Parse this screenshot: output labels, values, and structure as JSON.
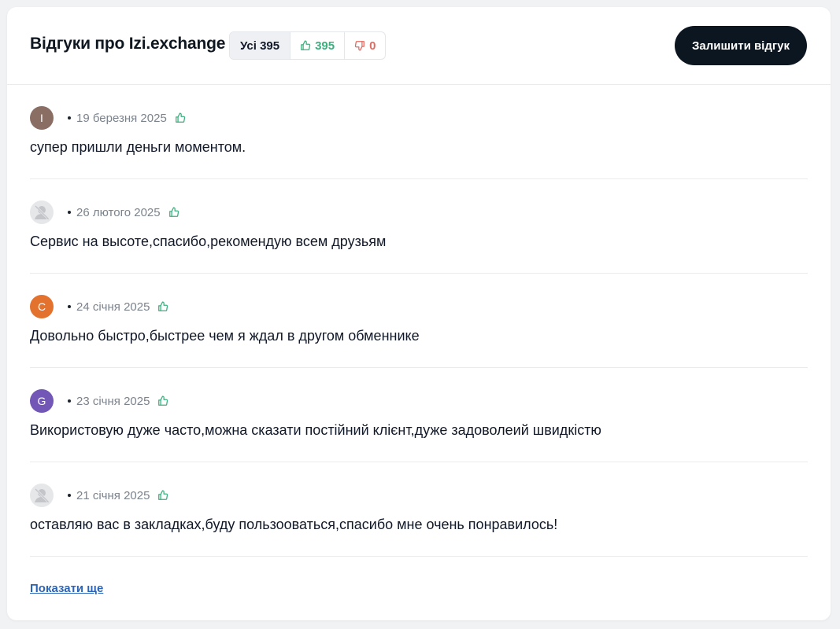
{
  "header": {
    "title": "Відгуки про Izi.exchange",
    "filters": {
      "all_label": "Усі 395",
      "positive_count": "395",
      "negative_count": "0"
    },
    "leave_review_label": "Залишити відгук"
  },
  "colors": {
    "positive": "#3fae7e",
    "negative": "#e26a60",
    "button_bg": "#0c1620",
    "link": "#2b63b5"
  },
  "reviews": [
    {
      "avatar_letter": "I",
      "avatar_color": "#8a6d63",
      "date": "19 березня 2025",
      "text": "супер пришли деньги моментом."
    },
    {
      "avatar_letter": "",
      "avatar_icon": "anonymous-user-icon",
      "date": "26 лютого 2025",
      "text": "Сервис на высоте,спасибо,рекомендую всем друзьям"
    },
    {
      "avatar_letter": "C",
      "avatar_color": "#e3722f",
      "date": "24 січня 2025",
      "text": "Довольно быстро,быстрее чем я ждал в другом обменнике"
    },
    {
      "avatar_letter": "G",
      "avatar_color": "#7357b6",
      "date": "23 січня 2025",
      "text": "Використовую дуже часто,можна сказати постійний клієнт,дуже задоволеий швидкістю"
    },
    {
      "avatar_letter": "",
      "avatar_icon": "anonymous-user-icon",
      "date": "21 січня 2025",
      "text": "оставляю вас в закладках,буду пользооваться,спасибо мне очень понравилось!"
    }
  ],
  "show_more_label": "Показати ще"
}
